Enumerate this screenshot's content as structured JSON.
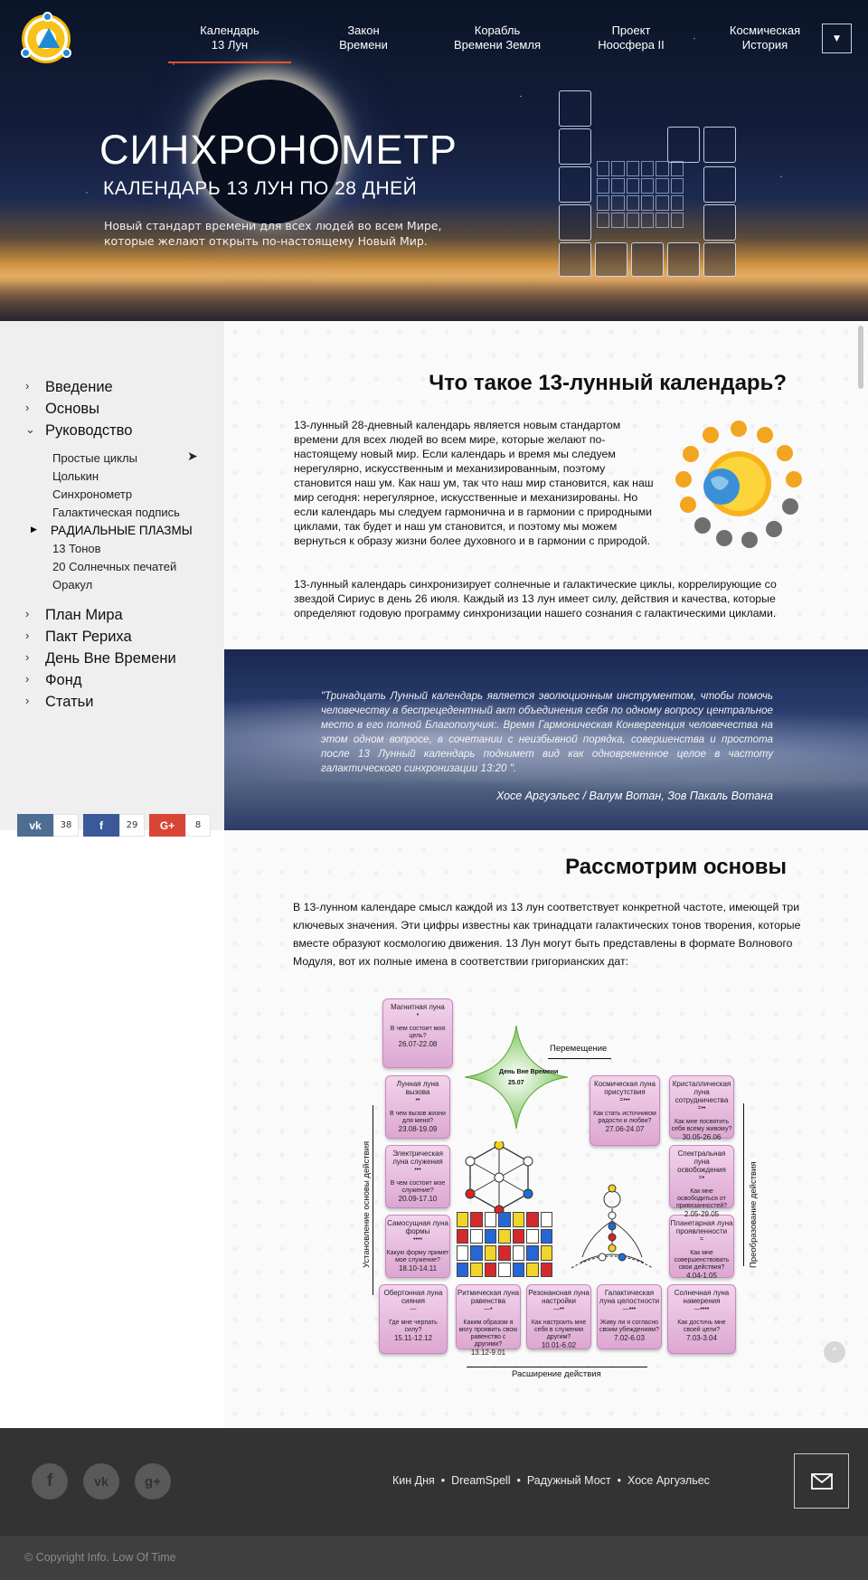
{
  "nav": {
    "items": [
      {
        "line1": "Календарь",
        "line2": "13 Лун"
      },
      {
        "line1": "Закон",
        "line2": "Времени"
      },
      {
        "line1": "Корабль",
        "line2": "Времени Земля"
      },
      {
        "line1": "Проект",
        "line2": "Ноосфера II"
      },
      {
        "line1": "Космическая",
        "line2": "История"
      }
    ],
    "menu_icon": "hamburger-icon"
  },
  "hero": {
    "title": "СИНХРОНОМЕТР",
    "subtitle": "КАЛЕНДАРЬ 13 ЛУН ПО 28 ДНЕЙ",
    "description": "Новый стандарт времени для всех людей во всем Мире, которые желают открыть по-настоящему Новый Мир."
  },
  "sidebar": {
    "items": [
      "Введение",
      "Основы",
      "Руководство"
    ],
    "sub_items": [
      "Простые циклы",
      "Цолькин",
      "Синхронометр",
      "Галактическая подпись",
      "РАДИАЛЬНЫЕ ПЛАЗМЫ",
      "13 Тонов",
      "20 Солнечных печатей",
      "Оракул"
    ],
    "items_after": [
      "План Мира",
      "Пакт Рериха",
      "День Вне Времени",
      "Фонд",
      "Статьи"
    ]
  },
  "share": {
    "vk": {
      "label": "vk",
      "count": "38"
    },
    "fb": {
      "label": "f",
      "count": "29"
    },
    "gp": {
      "label": "G+",
      "count": "8"
    }
  },
  "section1": {
    "title": "Что такое 13-лунный календарь?",
    "para1": "13-лунный 28-дневный календарь является новым стандартом времени для всех людей во всем мире, которые желают по-настоящему новый мир. Если календарь и время мы следуем нерегулярно, искусственным и механизированным, поэтому становится наш ум. Как наш ум, так что наш мир становится, как наш мир сегодня: нерегулярное, искусственные и механизированы. Но если календарь мы следуем гармонична и в гармонии с природными циклами, так будет и наш ум становится, и поэтому мы можем вернуться к образу жизни более духовного и в гармонии с природой.",
    "para2": "13-лунный календарь синхронизирует солнечные и галактические циклы,  коррелирующие со звездой Сириус в день 26 июля. Каждый из 13 лун имеет силу, действия и качества, которые определяют годовую программу синхронизации нашего сознания с галактическими циклами."
  },
  "quote": {
    "text": "\"Тринадцать Лунный календарь является эволюционным инструментом, чтобы помочь человечеству в беспрецедентный акт объединения себя по одному вопросу центральное место в его полной Благополучия:. Время Гармоническая Конвергенция человечества на этом одном вопросе, в сочетании с неизбывной порядка, совершенства и простота после 13 Лунный календарь поднимет вид как одновременное целое в частоту галактического синхронизации 13:20 \".",
    "author": "Хосе Аргуэльес / Валум Вотан, Зов Пакаль Вотана"
  },
  "section2": {
    "title": "Рассмотрим основы",
    "para": "В 13-лунном календаре смысл каждой из 13 лун соответствует конкретной частоте, имеющей три ключевых значения. Эти цифры известны как тринадцати галактических тонов творения, которые вместе образуют космологию движения. 13 Лун могут быть представлены в формате Волнового Модуля, вот их полные имена в соответствии григорианских дат:"
  },
  "wave_module": {
    "labels": {
      "left": "Установление основы действия",
      "right": "Преобразование действия",
      "bottom": "Расширение действия",
      "top": "Перемещение",
      "center": "День Вне Времени",
      "center_date": "25.07"
    },
    "moons": [
      {
        "name": "Магнитная луна",
        "dots": "•",
        "q": "В чем состоит моя цель?",
        "d": "26.07-22.08"
      },
      {
        "name": "Лунная луна вызова",
        "dots": "••",
        "q": "В чем вызов жизни для меня?",
        "d": "23.08-19.09"
      },
      {
        "name": "Электрическая луна служения",
        "dots": "•••",
        "q": "В чем состоит мое служение?",
        "d": "20.09-17.10"
      },
      {
        "name": "Самосущная луна формы",
        "dots": "••••",
        "q": "Какую форму примет мое служение?",
        "d": "18.10-14.11"
      },
      {
        "name": "Обертонная луна сияния",
        "dots": "—",
        "q": "Где мне черпать силу?",
        "d": "15.11-12.12"
      },
      {
        "name": "Ритмическая луна равенства",
        "dots": "—•",
        "q": "Каким образом я могу проявить свою равенство с другими?",
        "d": "13.12-9.01"
      },
      {
        "name": "Резонансная луна настройки",
        "dots": "—••",
        "q": "Как настроить мне себя в служении другим?",
        "d": "10.01-6.02"
      },
      {
        "name": "Галактическая луна целостности",
        "dots": "—•••",
        "q": "Живу ли я согласно своим убеждениям?",
        "d": "7.02-6.03"
      },
      {
        "name": "Солнечная луна намерения",
        "dots": "—••••",
        "q": "Как достичь мне своей цели?",
        "d": "7.03-3.04"
      },
      {
        "name": "Планетарная луна проявленности",
        "dots": "=",
        "q": "Как мне совершенствовать свои действия?",
        "d": "4.04-1.05"
      },
      {
        "name": "Спектральная луна освобождения",
        "dots": "=•",
        "q": "Как мне освободиться от привязанностей?",
        "d": "2.05-29.05"
      },
      {
        "name": "Кристаллическая луна сотрудничества",
        "dots": "=••",
        "q": "Как мне посвятить себя всему живому?",
        "d": "30.05-26.06"
      },
      {
        "name": "Космическая луна присутствия",
        "dots": "=•••",
        "q": "Как стать источником радости и любви?",
        "d": "27.06-24.07"
      }
    ]
  },
  "footer": {
    "links": [
      "Кин Дня",
      "DreamSpell",
      "Радужный Мост",
      "Хосе Аргуэльес"
    ],
    "separator": "•",
    "copyright": "© Copyright Info. Low Of Time",
    "social": [
      "facebook-icon",
      "vk-icon",
      "google-plus-icon"
    ]
  },
  "colors": {
    "accent": "#e5512a",
    "sidebar_bg": "#efefef",
    "footer_bg": "#333333",
    "moon_pink": "#dca7d2"
  }
}
